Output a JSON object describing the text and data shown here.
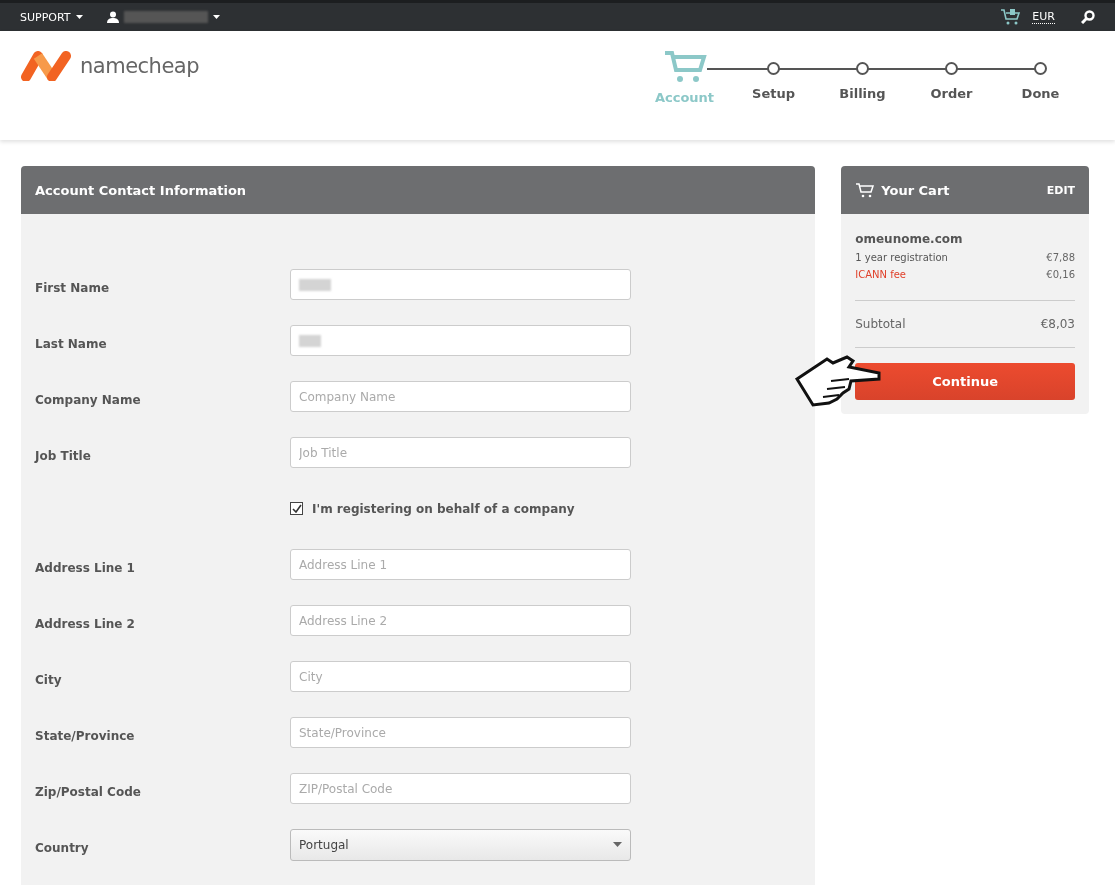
{
  "top_bar": {
    "support": "SUPPORT",
    "currency": "EUR"
  },
  "logo": {
    "text": "namecheap"
  },
  "steps": [
    {
      "label": "Account",
      "selected": true
    },
    {
      "label": "Setup",
      "selected": false
    },
    {
      "label": "Billing",
      "selected": false
    },
    {
      "label": "Order",
      "selected": false
    },
    {
      "label": "Done",
      "selected": false
    }
  ],
  "form": {
    "title": "Account Contact Information",
    "fields": [
      {
        "kind": "redacted",
        "label": "First Name"
      },
      {
        "kind": "redacted",
        "label": "Last Name"
      },
      {
        "kind": "text",
        "label": "Company Name",
        "placeholder": "Company Name"
      },
      {
        "kind": "text",
        "label": "Job Title",
        "placeholder": "Job Title"
      },
      {
        "kind": "checkbox",
        "text": "I'm registering on behalf of a company",
        "checked": true
      },
      {
        "kind": "text",
        "label": "Address Line 1",
        "placeholder": "Address Line 1"
      },
      {
        "kind": "text",
        "label": "Address Line 2",
        "placeholder": "Address Line 2"
      },
      {
        "kind": "text",
        "label": "City",
        "placeholder": "City"
      },
      {
        "kind": "text",
        "label": "State/Province",
        "placeholder": "State/Province"
      },
      {
        "kind": "text",
        "label": "Zip/Postal Code",
        "placeholder": "ZIP/Postal Code"
      },
      {
        "kind": "select",
        "label": "Country",
        "value": "Portugal"
      }
    ]
  },
  "cart": {
    "title": "Your Cart",
    "edit": "EDIT",
    "domain": "omeunome.com",
    "lines": [
      {
        "name": "1 year registration",
        "price": "€7,88",
        "color": "#555555"
      },
      {
        "name": "ICANN fee",
        "price": "€0,16",
        "color": "#e0402a"
      }
    ],
    "subtotal_label": "Subtotal",
    "subtotal": "€8,03",
    "button": "Continue"
  }
}
